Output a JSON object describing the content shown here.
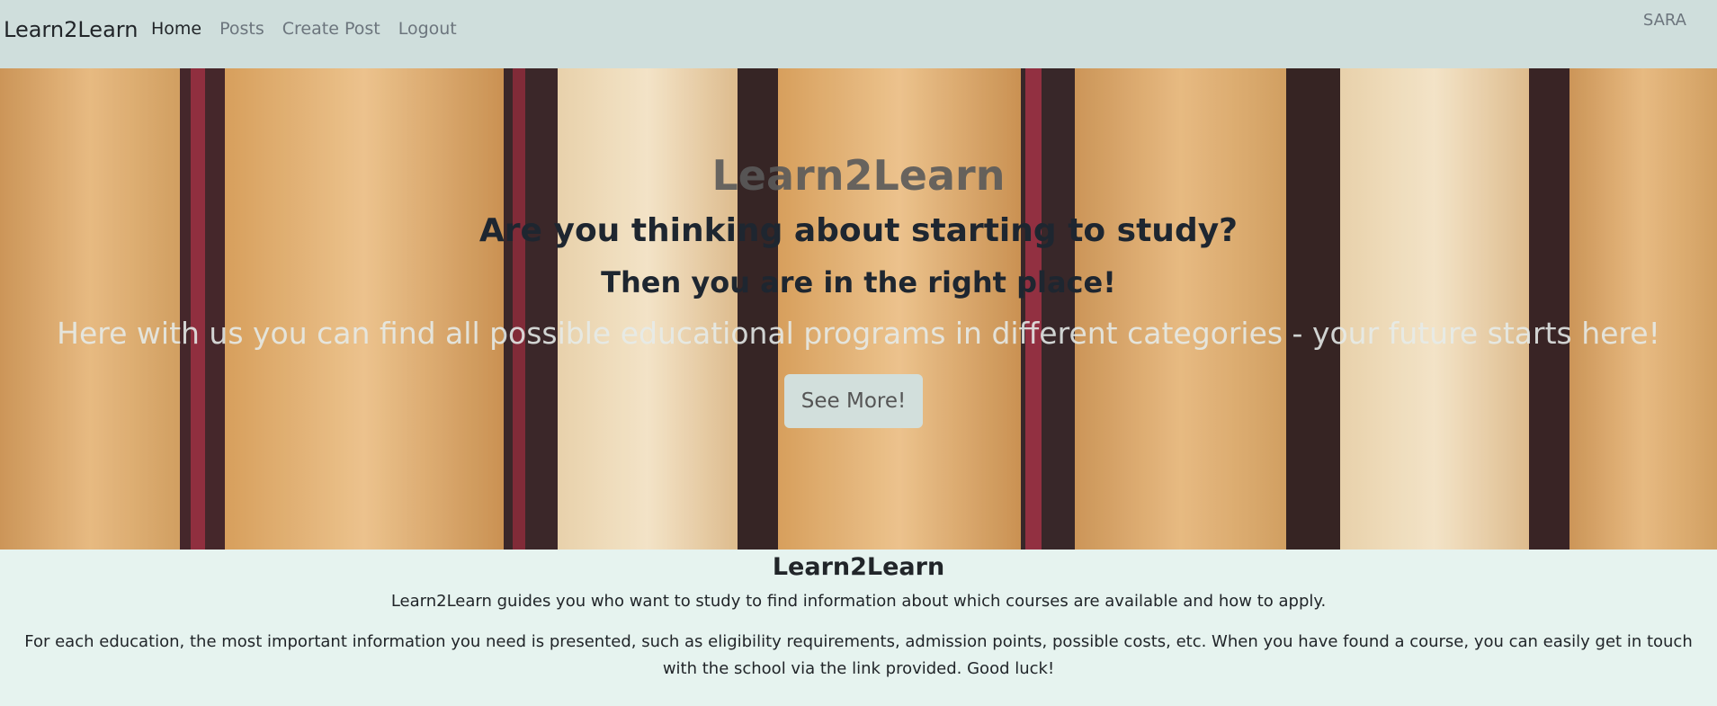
{
  "navbar": {
    "brand": "Learn2Learn",
    "links": [
      "Home",
      "Posts",
      "Create Post",
      "Logout"
    ],
    "active": "Home",
    "user": "SARA",
    "background": "#cfdedc"
  },
  "hero": {
    "title": "Learn2Learn",
    "subtitle1": "Are you thinking about starting to study?",
    "subtitle2": "Then you are in the right place!",
    "lead": "Here with us you can find all possible educational programs in different categories - your future starts here!",
    "button_label": "See More!",
    "background_image": "book-spines"
  },
  "about": {
    "title": "Learn2Learn",
    "paragraph1": "Learn2Learn guides you who want to study to find information about which courses are available and how to apply.",
    "paragraph2": "For each education, the most important information you need is presented, such as eligibility requirements, admission points, possible costs, etc. When you have found a course, you can easily get in touch with the school via the link provided. Good luck!",
    "background": "#e6f3ef"
  }
}
